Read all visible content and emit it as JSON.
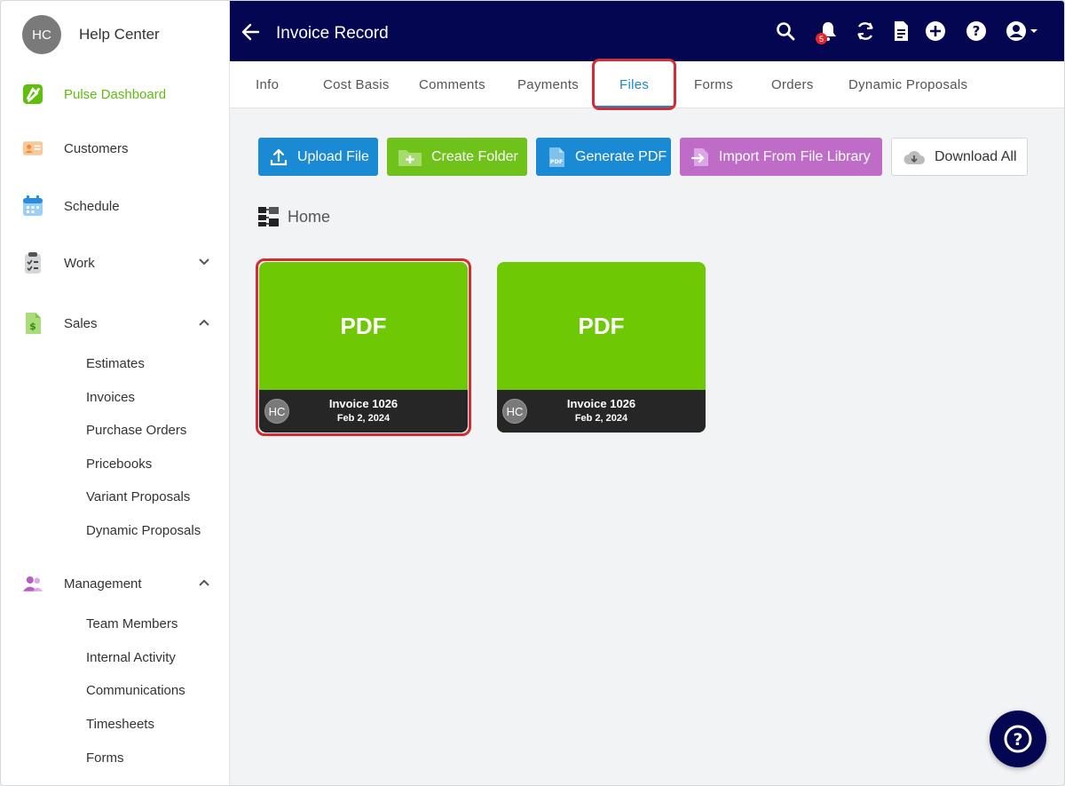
{
  "sidebar": {
    "avatar_initials": "HC",
    "title": "Help Center",
    "items": [
      {
        "label": "Pulse Dashboard",
        "icon": "pulse-logo-icon"
      },
      {
        "label": "Customers",
        "icon": "customer-card-icon"
      },
      {
        "label": "Schedule",
        "icon": "calendar-icon"
      },
      {
        "label": "Work",
        "icon": "clipboard-icon"
      },
      {
        "label": "Sales",
        "icon": "dollar-document-icon"
      },
      {
        "label": "Management",
        "icon": "people-icon"
      }
    ],
    "sales_sub": [
      "Estimates",
      "Invoices",
      "Purchase Orders",
      "Pricebooks",
      "Variant Proposals",
      "Dynamic Proposals"
    ],
    "management_sub": [
      "Team Members",
      "Internal Activity",
      "Communications",
      "Timesheets",
      "Forms"
    ]
  },
  "topbar": {
    "title": "Invoice Record",
    "notification_count": "5"
  },
  "tabs": [
    "Info",
    "Cost Basis",
    "Comments",
    "Payments",
    "Files",
    "Forms",
    "Orders",
    "Dynamic Proposals"
  ],
  "toolbar": {
    "upload": "Upload File",
    "create_folder": "Create Folder",
    "generate_pdf": "Generate PDF",
    "import_library": "Import From File Library",
    "download_all": "Download All"
  },
  "breadcrumb": {
    "label": "Home"
  },
  "files": [
    {
      "type": "PDF",
      "name": "Invoice 1026",
      "date": "Feb 2, 2024",
      "owner": "HC"
    },
    {
      "type": "PDF",
      "name": "Invoice 1026",
      "date": "Feb 2, 2024",
      "owner": "HC"
    }
  ],
  "colors": {
    "brand_navy": "#040651",
    "accent_green": "#6ec803",
    "accent_blue": "#1a8ad4",
    "accent_purple": "#bf6cc9",
    "highlight_red": "#d32c34"
  }
}
